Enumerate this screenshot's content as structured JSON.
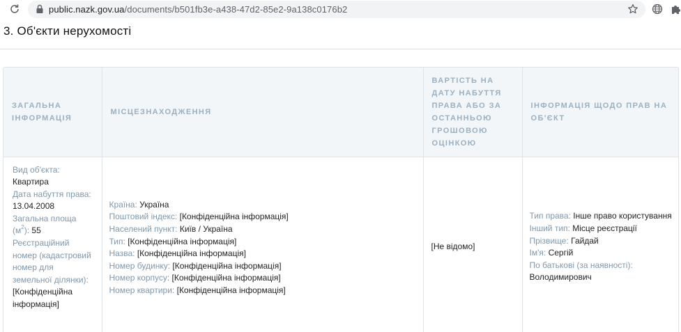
{
  "browser": {
    "url_domain": "public.nazk.gov.ua",
    "url_path": "/documents/b501fb3e-a438-47d2-85e2-9a138c0176b2"
  },
  "section": {
    "title": "3. Об'єкти нерухомості"
  },
  "table": {
    "headers": [
      "Загальна інформація",
      "Місцезнаходження",
      "Вартість на дату набуття права або за останньою грошовою оцінкою",
      "Інформація щодо прав на об'єкт"
    ],
    "row": {
      "general": {
        "object_type_label": "Вид об'єкта:",
        "object_type_value": "Квартира",
        "acquisition_date_label": "Дата набуття права:",
        "acquisition_date_value": "13.04.2008",
        "area_label": "Загальна площа (м",
        "area_unit_sup": "2",
        "area_label_end": "):",
        "area_value": "55",
        "reg_number_label": "Реєстраційний номер (кадастровий номер для земельної ділянки):",
        "reg_number_value": "[Конфіденційна інформація]"
      },
      "location": {
        "country_label": "Країна:",
        "country_value": "Україна",
        "postal_label": "Поштовий індекс:",
        "postal_value": "[Конфіденційна інформація]",
        "settlement_label": "Населений пункт:",
        "settlement_value": "Київ / Україна",
        "type_label": "Тип:",
        "type_value": "[Конфіденційна інформація]",
        "name_label": "Назва:",
        "name_value": "[Конфіденційна інформація]",
        "building_label": "Номер будинку:",
        "building_value": "[Конфіденційна інформація]",
        "block_label": "Номер корпусу:",
        "block_value": "[Конфіденційна інформація]",
        "apartment_label": "Номер квартири:",
        "apartment_value": "[Конфіденційна інформація]"
      },
      "cost": {
        "value": "[Не відомо]"
      },
      "rights": {
        "right_type_label": "Тип права:",
        "right_type_value": "Інше право користування",
        "other_type_label": "Інший тип:",
        "other_type_value": "Місце реєстрації",
        "surname_label": "Прізвище:",
        "surname_value": "Гайдай",
        "first_name_label": "Ім'я:",
        "first_name_value": "Сергій",
        "patronymic_label": "По батькові (за наявності):",
        "patronymic_value": "Володимирович"
      }
    }
  },
  "colors": {
    "header_bg": "#f2f6f8",
    "header_text": "#9bb0c0",
    "label_text": "#7f97ab",
    "border": "#dde3e8"
  },
  "icons": [
    "reload-icon",
    "lock-icon",
    "star-icon",
    "globe-icon",
    "puzzle-icon"
  ]
}
